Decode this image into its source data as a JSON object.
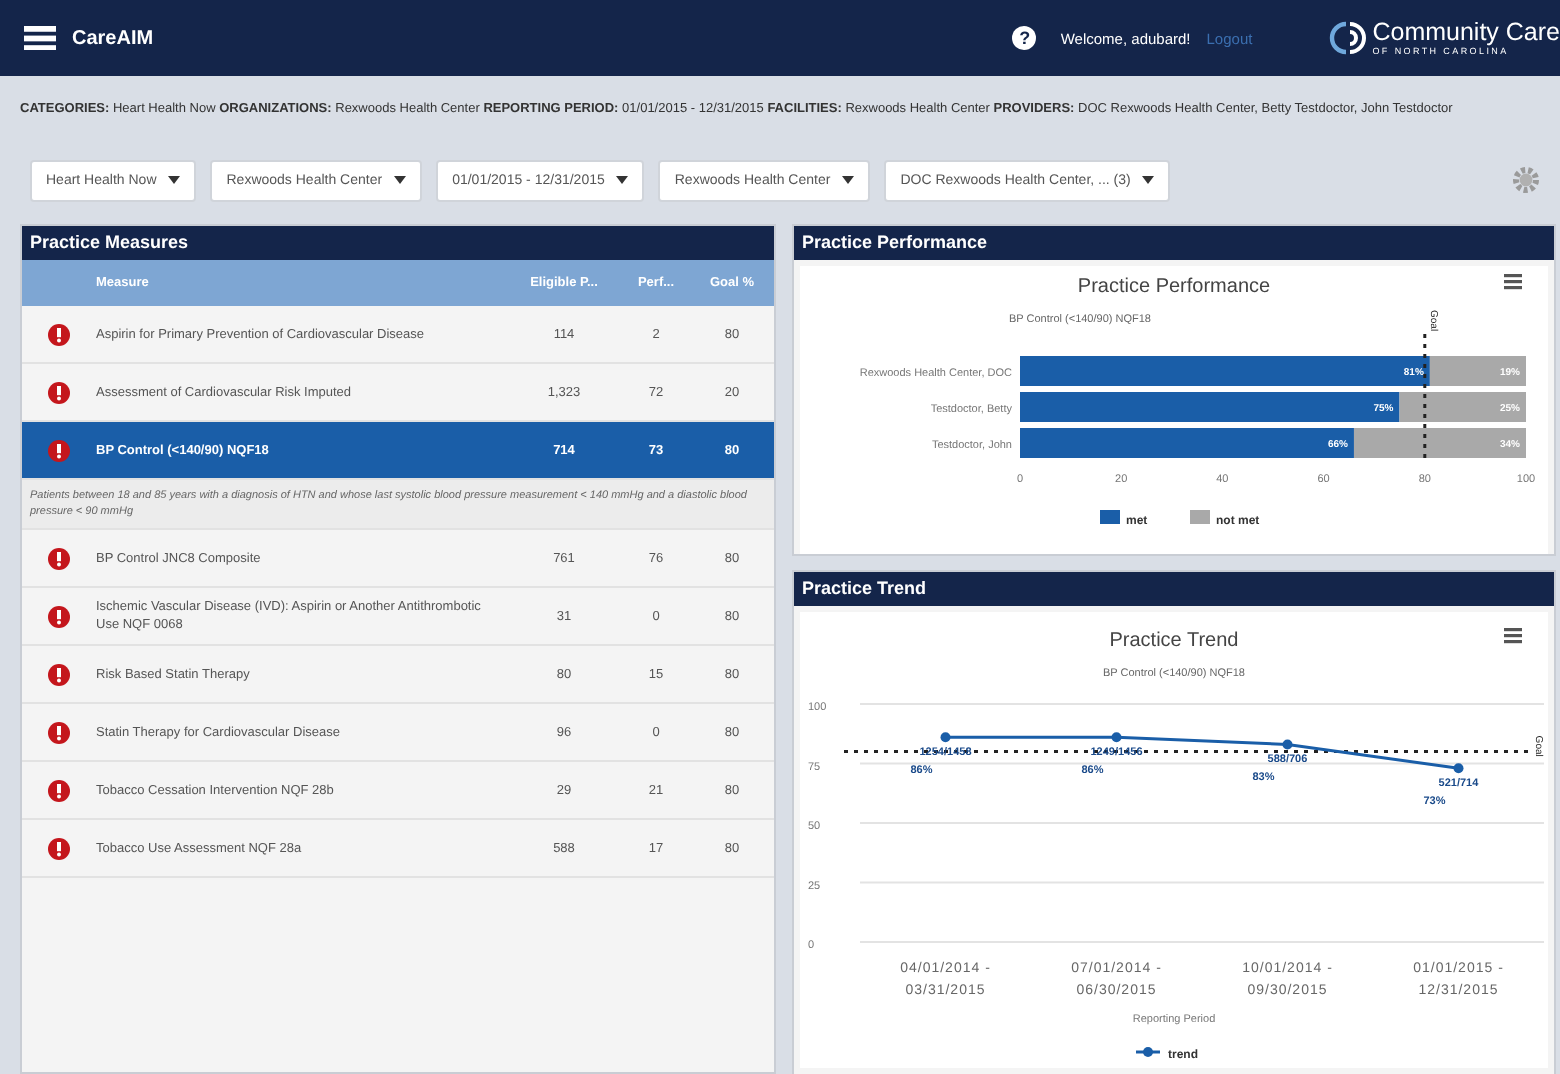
{
  "header": {
    "app_name": "CareAIM",
    "help": "?",
    "welcome": "Welcome, adubard!",
    "logout": "Logout",
    "logo_name": "Community Care",
    "logo_sub": "OF NORTH CAROLINA"
  },
  "filter_summary": "**CATEGORIES:** Heart Health Now **ORGANIZATIONS:** Rexwoods Health Center **REPORTING PERIOD:** 01/01/2015 - 12/31/2015 **FACILITIES:** Rexwoods Health Center **PROVIDERS:** DOC Rexwoods Health Center, Betty Testdoctor, John Testdoctor",
  "filters": [
    "Heart Health Now",
    "Rexwoods Health Center",
    "01/01/2015 - 12/31/2015",
    "Rexwoods Health Center",
    "DOC Rexwoods Health Center, ... (3)"
  ],
  "measures_panel": {
    "title": "Practice Measures",
    "columns": [
      "Measure",
      "Eligible P...",
      "Perf...",
      "Goal %"
    ],
    "rows": [
      {
        "measure": "Aspirin for Primary Prevention of Cardiovascular Disease",
        "eligible": "114",
        "perf": "2",
        "goal": "80",
        "selected": false
      },
      {
        "measure": "Assessment of Cardiovascular Risk Imputed",
        "eligible": "1,323",
        "perf": "72",
        "goal": "20",
        "selected": false
      },
      {
        "measure": "BP Control (<140/90) NQF18",
        "eligible": "714",
        "perf": "73",
        "goal": "80",
        "selected": true,
        "description": "Patients between 18 and 85 years with a diagnosis of HTN and whose last systolic blood pressure measurement < 140 mmHg and a diastolic blood pressure < 90 mmHg"
      },
      {
        "measure": "BP Control JNC8 Composite",
        "eligible": "761",
        "perf": "76",
        "goal": "80",
        "selected": false
      },
      {
        "measure": "Ischemic Vascular Disease (IVD): Aspirin or Another Antithrombotic Use NQF 0068",
        "eligible": "31",
        "perf": "0",
        "goal": "80",
        "selected": false
      },
      {
        "measure": "Risk Based Statin Therapy",
        "eligible": "80",
        "perf": "15",
        "goal": "80",
        "selected": false
      },
      {
        "measure": "Statin Therapy for Cardiovascular Disease",
        "eligible": "96",
        "perf": "0",
        "goal": "80",
        "selected": false
      },
      {
        "measure": "Tobacco Cessation Intervention NQF 28b",
        "eligible": "29",
        "perf": "21",
        "goal": "80",
        "selected": false
      },
      {
        "measure": "Tobacco Use Assessment NQF 28a",
        "eligible": "588",
        "perf": "17",
        "goal": "80",
        "selected": false
      }
    ]
  },
  "performance_panel": {
    "title": "Practice Performance",
    "chart_data": {
      "type": "bar",
      "orientation": "horizontal",
      "stacked": true,
      "title": "Practice Performance",
      "subtitle": "BP Control (<140/90) NQF18",
      "categories": [
        "Rexwoods Health Center, DOC",
        "Testdoctor, Betty",
        "Testdoctor, John"
      ],
      "series": [
        {
          "name": "met",
          "color": "#1a5ea8",
          "values": [
            81,
            75,
            66
          ],
          "value_labels": [
            "81%",
            "75%",
            "66%"
          ]
        },
        {
          "name": "not met",
          "color": "#a9a9a9",
          "values": [
            19,
            25,
            34
          ],
          "value_labels": [
            "19%",
            "25%",
            "34%"
          ]
        }
      ],
      "xlim": [
        0,
        100
      ],
      "xticks": [
        0,
        20,
        40,
        60,
        80,
        100
      ],
      "legend": "bottom",
      "ref_lines": [
        {
          "axis": "x",
          "value": 80,
          "label": "Goal"
        }
      ]
    }
  },
  "trend_panel": {
    "title": "Practice Trend",
    "chart_data": {
      "type": "line",
      "title": "Practice Trend",
      "subtitle": "BP Control (<140/90) NQF18",
      "xlabel": "Reporting Period",
      "categories": [
        "04/01/2014 -\n03/31/2015",
        "07/01/2014 -\n06/30/2015",
        "10/01/2014 -\n09/30/2015",
        "01/01/2015 -\n12/31/2015"
      ],
      "series": [
        {
          "name": "trend",
          "color": "#1a5ea8",
          "marker": "circle",
          "values": [
            86,
            86,
            83,
            73
          ],
          "value_labels": [
            "1254/1458\n86%",
            "1249/1456\n86%",
            "588/706\n83%",
            "521/714\n73%"
          ]
        }
      ],
      "ylim": [
        0,
        100
      ],
      "yticks": [
        0,
        25,
        50,
        75,
        100
      ],
      "grid": true,
      "legend": "bottom",
      "ref_lines": [
        {
          "axis": "y",
          "value": 80,
          "label": "Goal"
        }
      ]
    }
  }
}
